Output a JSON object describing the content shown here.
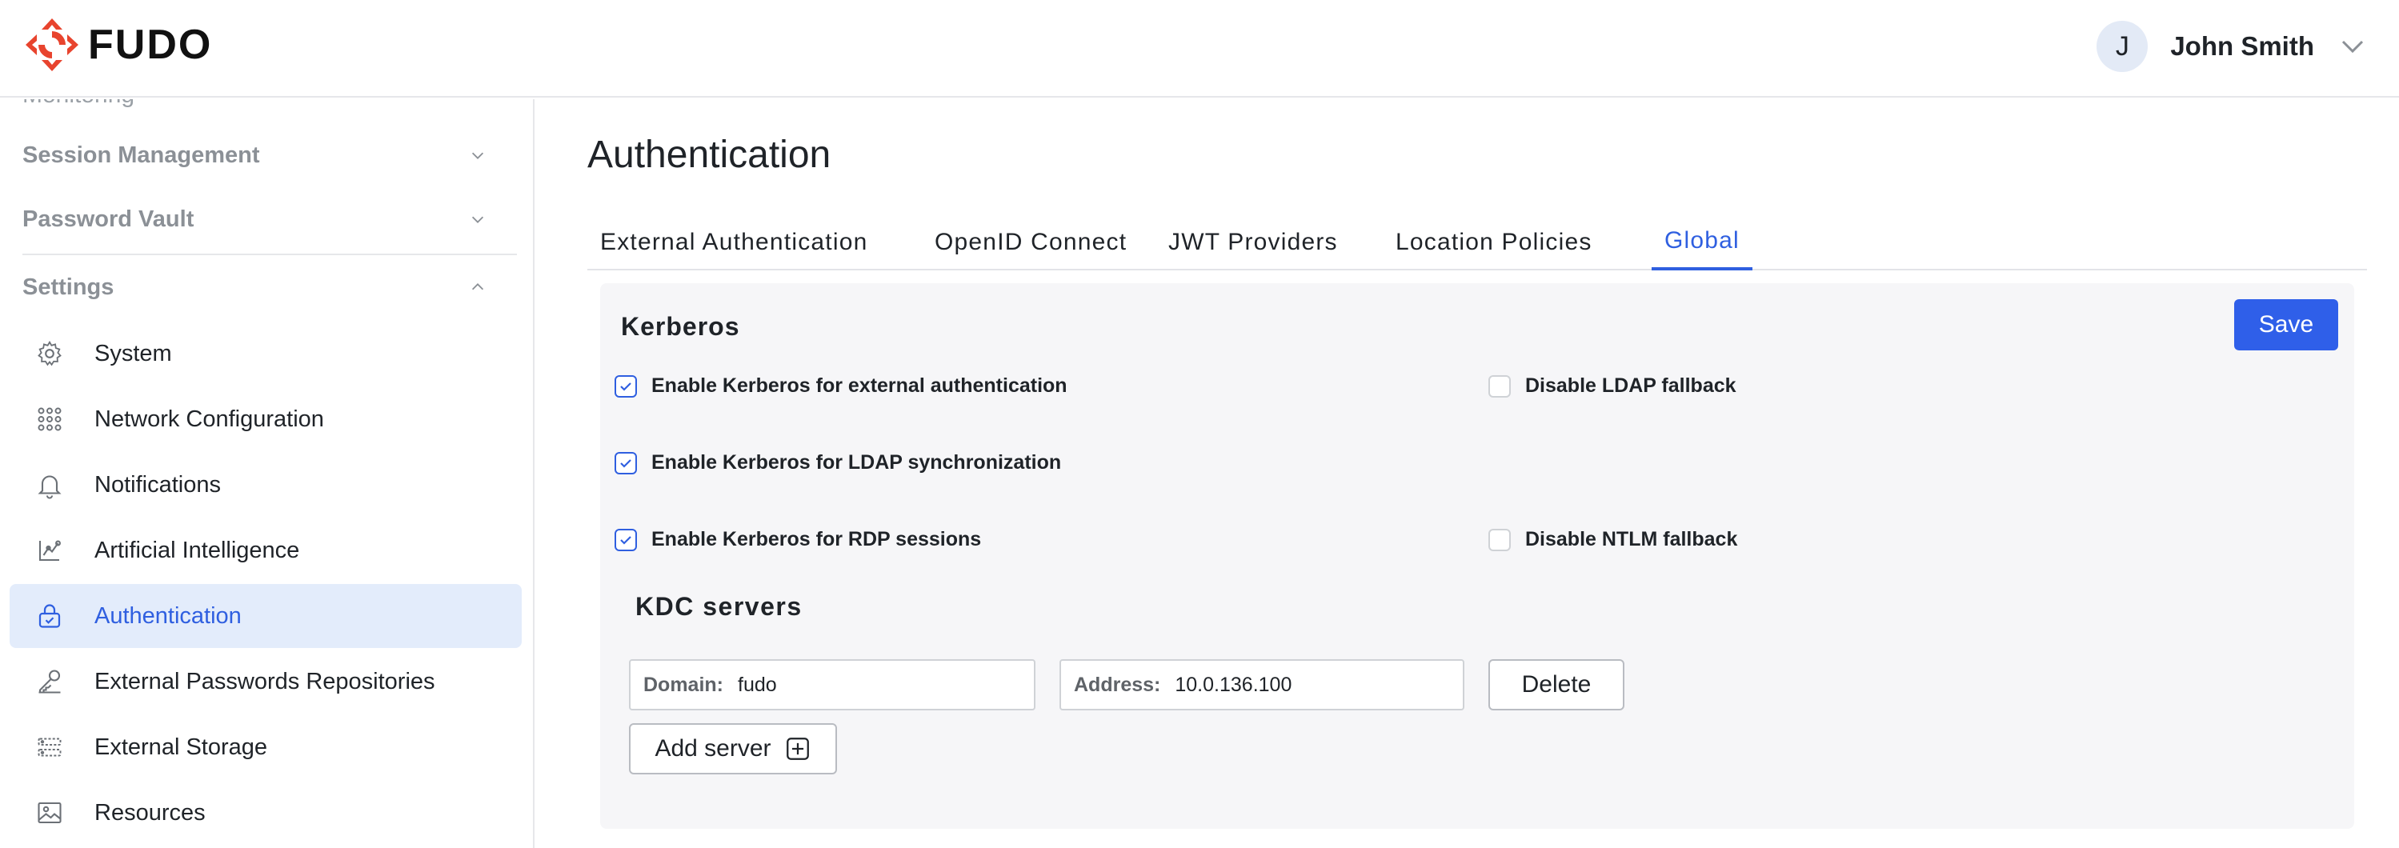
{
  "brand": {
    "name": "FUDO",
    "accent": "#e8442e"
  },
  "user": {
    "initial": "J",
    "name": "John Smith"
  },
  "sidebar": {
    "cut_text": "Monitoring",
    "groups": [
      {
        "label": "Session Management"
      },
      {
        "label": "Password Vault"
      },
      {
        "label": "Settings"
      }
    ],
    "items": [
      {
        "label": "System",
        "icon": "gear-icon"
      },
      {
        "label": "Network Configuration",
        "icon": "network-icon"
      },
      {
        "label": "Notifications",
        "icon": "bell-icon"
      },
      {
        "label": "Artificial Intelligence",
        "icon": "ai-icon"
      },
      {
        "label": "Authentication",
        "icon": "lock-icon",
        "active": true
      },
      {
        "label": "External Passwords Repositories",
        "icon": "key-icon"
      },
      {
        "label": "External Storage",
        "icon": "storage-icon"
      },
      {
        "label": "Resources",
        "icon": "image-icon"
      }
    ]
  },
  "main": {
    "title": "Authentication",
    "tabs": [
      {
        "label": "External Authentication"
      },
      {
        "label": "OpenID Connect"
      },
      {
        "label": "JWT Providers"
      },
      {
        "label": "Location Policies"
      },
      {
        "label": "Global",
        "active": true
      }
    ],
    "panel": {
      "title": "Kerberos",
      "save_label": "Save",
      "options": [
        {
          "label": "Enable Kerberos for external authentication",
          "checked": true
        },
        {
          "label": "Disable LDAP fallback",
          "checked": false
        },
        {
          "label": "Enable Kerberos for LDAP synchronization",
          "checked": true
        },
        {
          "label": "Enable Kerberos for RDP sessions",
          "checked": true
        },
        {
          "label": "Disable NTLM fallback",
          "checked": false
        }
      ],
      "kdc": {
        "title": "KDC servers",
        "domain_label": "Domain:",
        "domain_value": "fudo",
        "address_label": "Address:",
        "address_value": "10.0.136.100",
        "delete_label": "Delete",
        "add_label": "Add server"
      }
    }
  }
}
